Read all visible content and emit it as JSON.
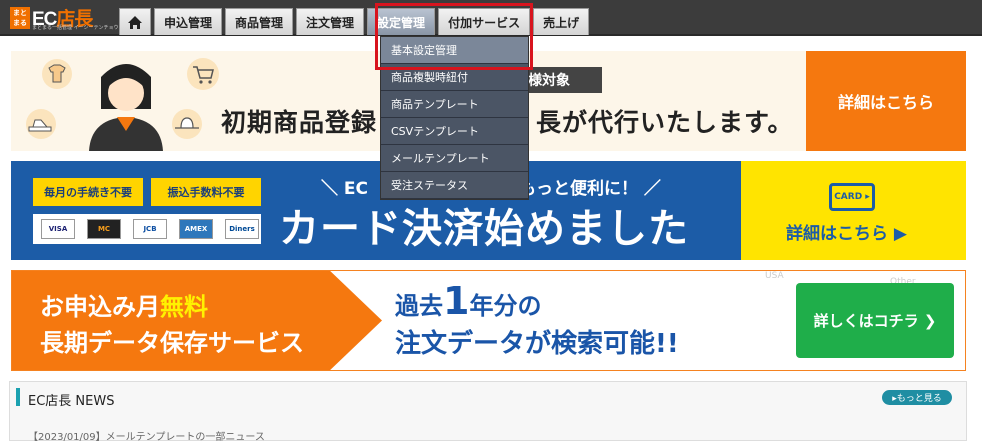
{
  "logo": {
    "mark": "まとまる",
    "name_prefix": "EC",
    "name_suffix": "店長",
    "tagline": "まとまる一括管理 イーシーテンチョウ"
  },
  "nav": {
    "tabs": [
      "申込管理",
      "商品管理",
      "注文管理",
      "設定管理",
      "付加サービス",
      "売上げ"
    ],
    "active_tab": "設定管理"
  },
  "dropdown": {
    "items": [
      "基本設定管理",
      "商品複製時紐付",
      "商品テンプレート",
      "CSVテンプレート",
      "メールテンプレート",
      "受注ステータス"
    ]
  },
  "banner1": {
    "tag": "様対象",
    "headline_left": "初期商品登録",
    "headline_right": "長が代行いたします。",
    "cta": "詳細はこちら"
  },
  "banner2": {
    "pill1": "毎月の手続き不要",
    "pill2": "振込手数料不要",
    "cards": [
      "VISA",
      "MC",
      "JCB",
      "AMEX",
      "Diners"
    ],
    "sub_left": "＼ EC",
    "sub_right": "もっと便利に！ ／",
    "headline": "カード決済始めました",
    "cta_icon": "CARD ▸",
    "cta": "詳細はこちら ▶"
  },
  "banner3": {
    "line1_prefix": "お申込み月",
    "line1_highlight": "無料",
    "line2": "長期データ保存サービス",
    "right1_prefix": "過去",
    "right1_number": "1",
    "right1_suffix": "年分の",
    "right2": "注文データが検索可能!!",
    "bg_label1": "USA",
    "bg_label2": "Other",
    "cta": "詳しくはコチラ ❯"
  },
  "news": {
    "title": "EC店長 NEWS",
    "more": "▸もっと見る",
    "line": "【2023/01/09】メールテンプレートの一部ニュース"
  }
}
